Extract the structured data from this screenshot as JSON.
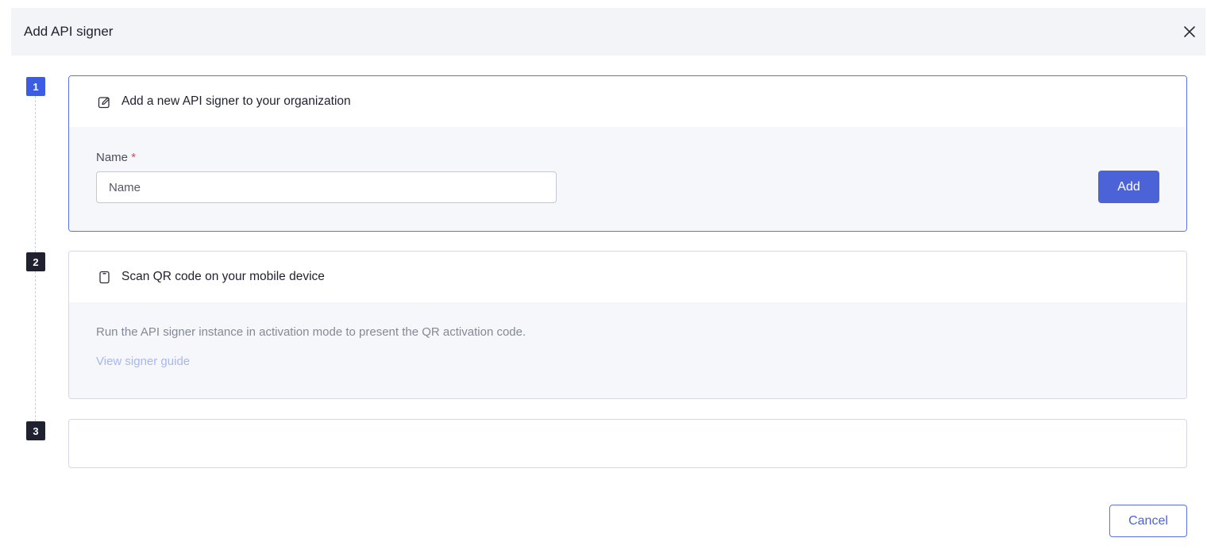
{
  "dialog": {
    "title": "Add API signer",
    "close_icon": "close-icon"
  },
  "steps": [
    {
      "number": "1",
      "title": "Add a new API signer to your organization",
      "icon": "edit-square-icon",
      "field_label": "Name",
      "required_mark": "*",
      "input_value": "",
      "input_placeholder": "Name",
      "button_label": "Add"
    },
    {
      "number": "2",
      "title": "Scan QR code on your mobile device",
      "icon": "mobile-device-icon",
      "description": "Run the API signer instance in activation mode to present the QR activation code.",
      "link_label": "View signer guide"
    },
    {
      "number": "3"
    }
  ],
  "footer": {
    "cancel_label": "Cancel"
  },
  "colors": {
    "accent": "#4c63d8",
    "active_badge": "#3d5ce4",
    "inactive_badge": "#1f2130",
    "required": "#e0435a",
    "link": "#a9b6ee"
  }
}
